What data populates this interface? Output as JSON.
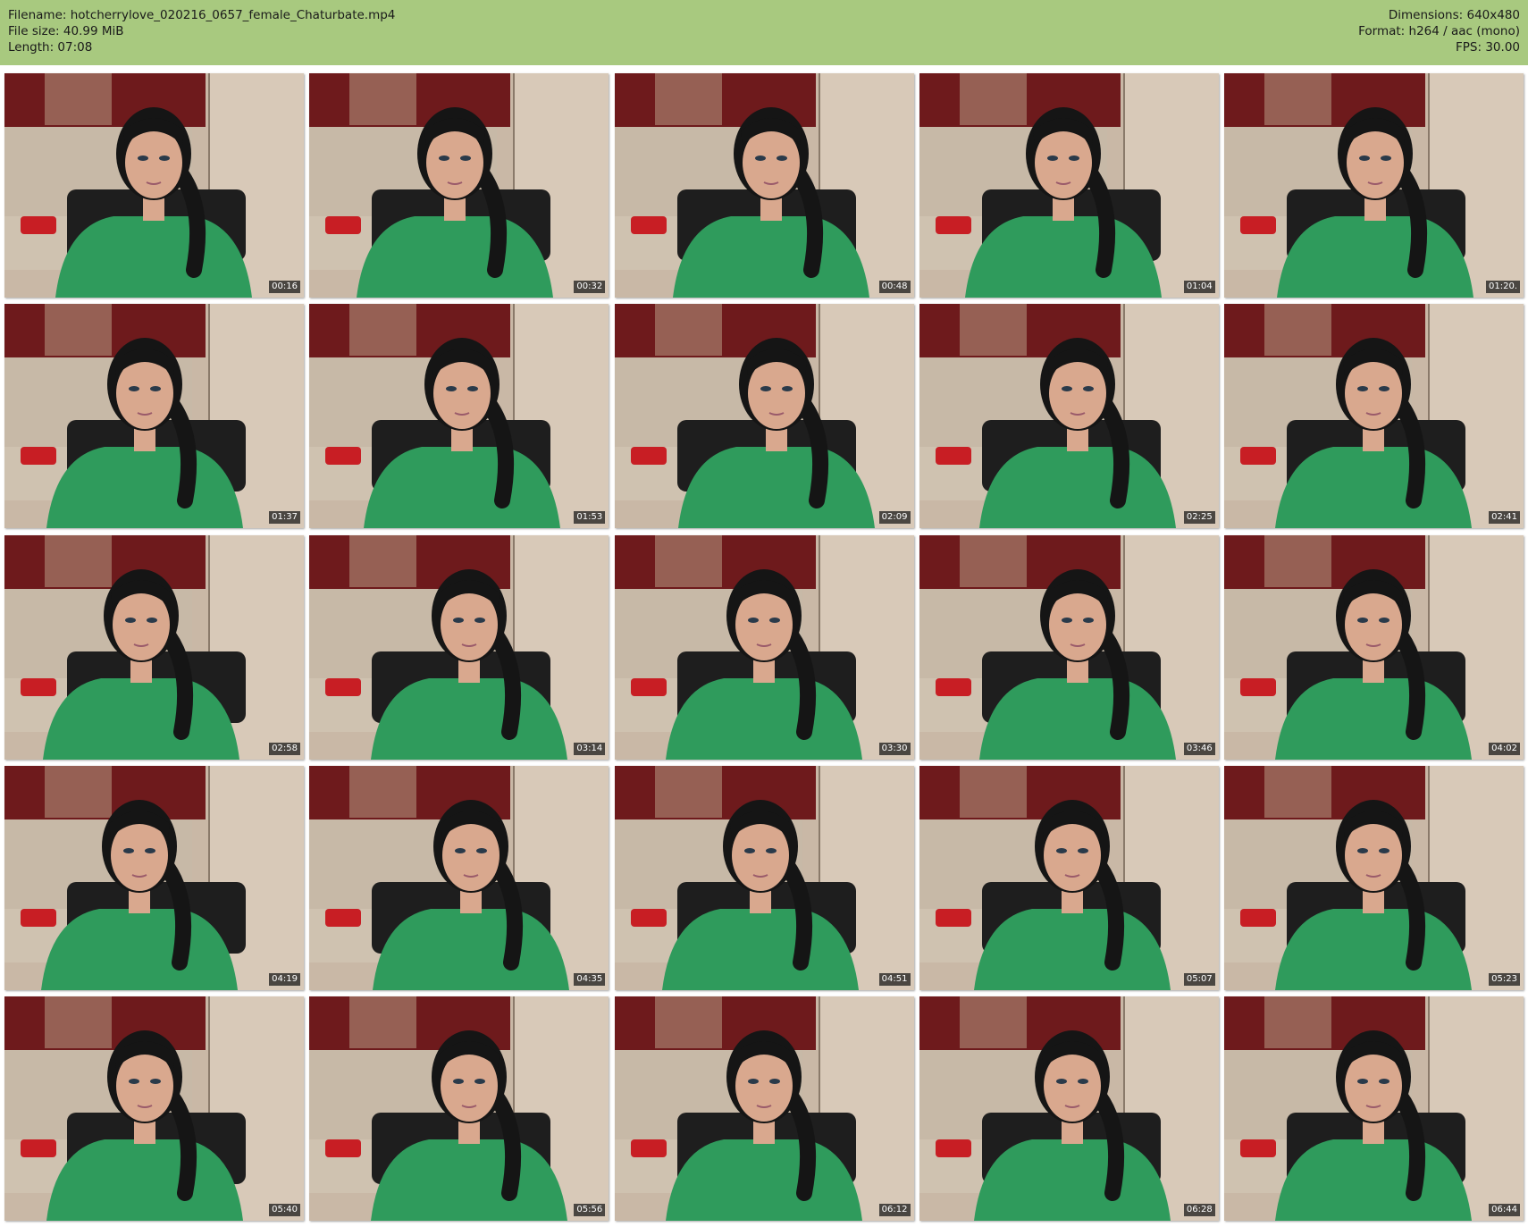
{
  "header": {
    "filename": "Filename: hotcherrylove_020216_0657_female_Chaturbate.mp4",
    "file_size": "File size: 40.99 MiB",
    "length": "Length: 07:08",
    "dimensions": "Dimensions: 640x480",
    "format": "Format: h264 / aac (mono)",
    "fps": "FPS: 30.00",
    "background_color": "#a8c97f"
  },
  "thumbnails": [
    {
      "timestamp": "00:16"
    },
    {
      "timestamp": "00:32"
    },
    {
      "timestamp": "00:48"
    },
    {
      "timestamp": "01:04"
    },
    {
      "timestamp": "01:20."
    },
    {
      "timestamp": "01:37"
    },
    {
      "timestamp": "01:53"
    },
    {
      "timestamp": "02:09"
    },
    {
      "timestamp": "02:25"
    },
    {
      "timestamp": "02:41"
    },
    {
      "timestamp": "02:58"
    },
    {
      "timestamp": "03:14"
    },
    {
      "timestamp": "03:30"
    },
    {
      "timestamp": "03:46"
    },
    {
      "timestamp": "04:02"
    },
    {
      "timestamp": "04:19"
    },
    {
      "timestamp": "04:35"
    },
    {
      "timestamp": "04:51"
    },
    {
      "timestamp": "05:07"
    },
    {
      "timestamp": "05:23"
    },
    {
      "timestamp": "05:40"
    },
    {
      "timestamp": "05:56"
    },
    {
      "timestamp": "06:12"
    },
    {
      "timestamp": "06:28"
    },
    {
      "timestamp": "06:44"
    }
  ],
  "colors": {
    "wall": "#c9b8a6",
    "curtain": "#6e1a1c",
    "sofa": "#cfc2b0",
    "shirt": "#2f9b5c",
    "hair": "#151515",
    "skin": "#d9a88e",
    "pillow": "#c81e24",
    "floor": "#c8a06a",
    "door": "#d8c9b8"
  }
}
